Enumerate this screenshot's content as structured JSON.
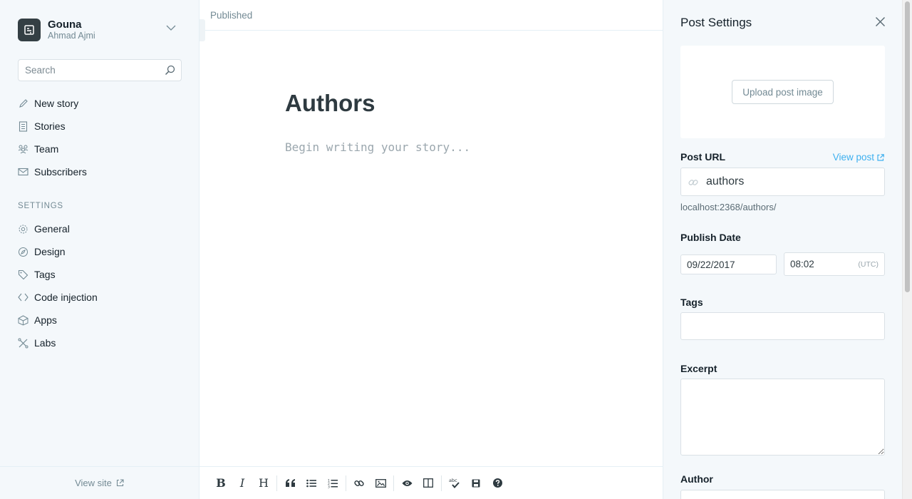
{
  "sidebar": {
    "blog_title": "Gouna",
    "user_name": "Ahmad Ajmi",
    "search_placeholder": "Search",
    "main_nav": [
      {
        "label": "New story",
        "icon": "pencil-icon"
      },
      {
        "label": "Stories",
        "icon": "document-icon"
      },
      {
        "label": "Team",
        "icon": "team-icon"
      },
      {
        "label": "Subscribers",
        "icon": "mail-icon"
      }
    ],
    "settings_label": "SETTINGS",
    "settings_nav": [
      {
        "label": "General",
        "icon": "gear-icon"
      },
      {
        "label": "Design",
        "icon": "compass-icon"
      },
      {
        "label": "Tags",
        "icon": "tag-icon"
      },
      {
        "label": "Code injection",
        "icon": "code-icon"
      },
      {
        "label": "Apps",
        "icon": "box-icon"
      },
      {
        "label": "Labs",
        "icon": "labs-icon"
      }
    ],
    "view_site": "View site"
  },
  "editor": {
    "status": "Published",
    "title": "Authors",
    "body_placeholder": "Begin writing your story...",
    "toolbar": {
      "bold": "B",
      "italic": "I",
      "heading": "H"
    }
  },
  "settings": {
    "title": "Post Settings",
    "upload_label": "Upload post image",
    "post_url_label": "Post URL",
    "view_post": "View post",
    "slug": "authors",
    "url_preview": "localhost:2368/authors/",
    "publish_date_label": "Publish Date",
    "date": "09/22/2017",
    "time": "08:02",
    "timezone": "(UTC)",
    "tags_label": "Tags",
    "excerpt_label": "Excerpt",
    "author_label": "Author"
  },
  "colors": {
    "accent": "#3eb0ef",
    "sidebar_bg": "#f4f8fb",
    "text": "#15212a",
    "muted": "#738a94"
  }
}
